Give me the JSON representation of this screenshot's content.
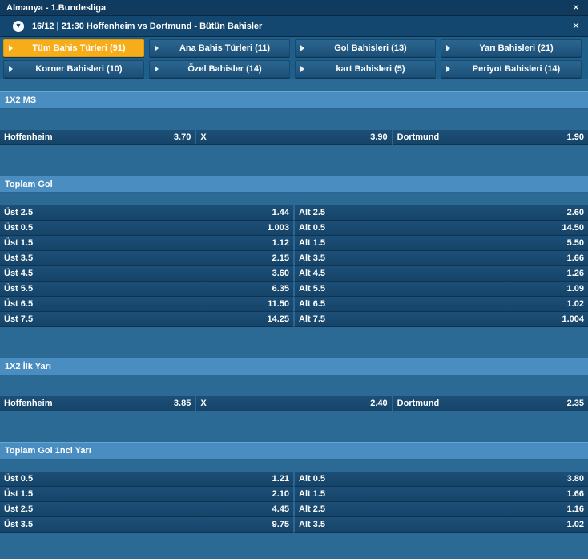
{
  "league": {
    "title": "Almanya - 1.Bundesliga",
    "close": "✕"
  },
  "match": {
    "title": "16/12 | 21:30 Hoffenheim vs Dortmund - Bütün Bahisler",
    "chevron": "⌄",
    "close": "✕"
  },
  "tabs": [
    {
      "label": "Tüm Bahis Türleri (91)",
      "active": true
    },
    {
      "label": "Ana Bahis Türleri (11)"
    },
    {
      "label": "Gol Bahisleri (13)"
    },
    {
      "label": "Yarı Bahisleri (21)"
    },
    {
      "label": "Korner Bahisleri (10)"
    },
    {
      "label": "Özel Bahisler (14)"
    },
    {
      "label": "kart Bahisleri (5)"
    },
    {
      "label": "Periyot Bahisleri (14)"
    }
  ],
  "sections": {
    "ms": {
      "title": "1X2 MS",
      "cells": [
        {
          "name": "Hoffenheim",
          "odd": "3.70"
        },
        {
          "name": "X",
          "odd": "3.90"
        },
        {
          "name": "Dortmund",
          "odd": "1.90"
        }
      ]
    },
    "toplam_gol": {
      "title": "Toplam Gol",
      "rows": [
        {
          "l_name": "Üst 2.5",
          "l_odd": "1.44",
          "r_name": "Alt 2.5",
          "r_odd": "2.60"
        },
        {
          "l_name": "Üst 0.5",
          "l_odd": "1.003",
          "r_name": "Alt 0.5",
          "r_odd": "14.50"
        },
        {
          "l_name": "Üst 1.5",
          "l_odd": "1.12",
          "r_name": "Alt 1.5",
          "r_odd": "5.50"
        },
        {
          "l_name": "Üst 3.5",
          "l_odd": "2.15",
          "r_name": "Alt 3.5",
          "r_odd": "1.66"
        },
        {
          "l_name": "Üst 4.5",
          "l_odd": "3.60",
          "r_name": "Alt 4.5",
          "r_odd": "1.26"
        },
        {
          "l_name": "Üst 5.5",
          "l_odd": "6.35",
          "r_name": "Alt 5.5",
          "r_odd": "1.09"
        },
        {
          "l_name": "Üst 6.5",
          "l_odd": "11.50",
          "r_name": "Alt 6.5",
          "r_odd": "1.02"
        },
        {
          "l_name": "Üst 7.5",
          "l_odd": "14.25",
          "r_name": "Alt 7.5",
          "r_odd": "1.004"
        }
      ]
    },
    "ilk_yari": {
      "title": "1X2 İlk Yarı",
      "cells": [
        {
          "name": "Hoffenheim",
          "odd": "3.85"
        },
        {
          "name": "X",
          "odd": "2.40"
        },
        {
          "name": "Dortmund",
          "odd": "2.35"
        }
      ]
    },
    "gol_1inci_yari": {
      "title": "Toplam Gol 1nci Yarı",
      "rows": [
        {
          "l_name": "Üst 0.5",
          "l_odd": "1.21",
          "r_name": "Alt 0.5",
          "r_odd": "3.80"
        },
        {
          "l_name": "Üst 1.5",
          "l_odd": "2.10",
          "r_name": "Alt 1.5",
          "r_odd": "1.66"
        },
        {
          "l_name": "Üst 2.5",
          "l_odd": "4.45",
          "r_name": "Alt 2.5",
          "r_odd": "1.16"
        },
        {
          "l_name": "Üst 3.5",
          "l_odd": "9.75",
          "r_name": "Alt 3.5",
          "r_odd": "1.02"
        }
      ]
    }
  },
  "colors": {
    "accent": "#f7ad1a",
    "header": "#4a8dc0",
    "background": "#2b6a95",
    "cell": "#1c4f78"
  }
}
